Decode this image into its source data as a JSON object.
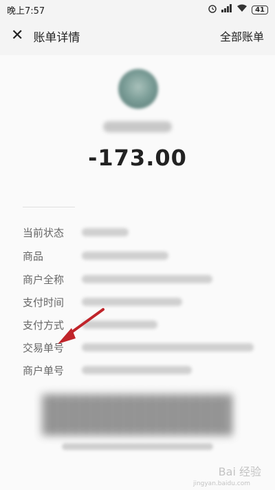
{
  "status_bar": {
    "time": "晚上7:57",
    "alarm_icon": "alarm-icon",
    "signal_icon": "signal-icon",
    "wifi_icon": "wifi-icon",
    "battery": "41"
  },
  "nav": {
    "close_icon": "close-icon",
    "title": "账单详情",
    "right_action": "全部账单"
  },
  "bill": {
    "amount": "-173.00"
  },
  "details": [
    {
      "label": "当前状态"
    },
    {
      "label": "商品"
    },
    {
      "label": "商户全称"
    },
    {
      "label": "支付时间"
    },
    {
      "label": "支付方式"
    },
    {
      "label": "交易单号"
    },
    {
      "label": "商户单号"
    }
  ],
  "colors": {
    "background": "#f4f4f4",
    "card": "#fafafa",
    "annotation_arrow": "#c0242a"
  },
  "watermark": {
    "text": "Bai 经验",
    "url": "jingyan.baidu.com"
  }
}
